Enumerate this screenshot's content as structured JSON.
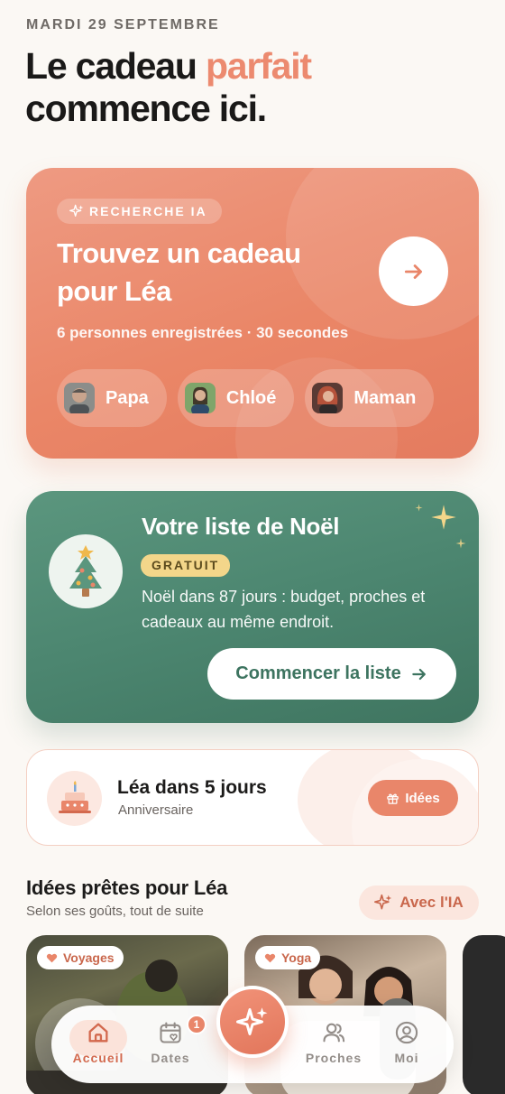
{
  "header": {
    "date": "MARDI 29 SEPTEMBRE",
    "headline_part1": "Le cadeau ",
    "headline_accent": "parfait",
    "headline_part2": "commence ici."
  },
  "ai_card": {
    "badge": "RECHERCHE IA",
    "title": "Trouvez un cadeau pour Léa",
    "subtitle": "6 personnes enregistrées · 30 secondes",
    "people": [
      {
        "name": "Papa"
      },
      {
        "name": "Chloé"
      },
      {
        "name": "Maman"
      }
    ]
  },
  "noel_card": {
    "title": "Votre liste de Noël",
    "badge": "GRATUIT",
    "description": "Noël dans 87 jours : budget, proches et cadeaux au même endroit.",
    "button": "Commencer la liste"
  },
  "birthday": {
    "title": "Léa dans 5 jours",
    "subtitle": "Anniversaire",
    "button": "Idées"
  },
  "ideas_section": {
    "title": "Idées prêtes pour Léa",
    "subtitle": "Selon ses goûts, tout de suite",
    "ai_button": "Avec l'IA",
    "cards": [
      {
        "tag": "Voyages"
      },
      {
        "tag": "Yoga"
      }
    ]
  },
  "tabbar": {
    "home": "Accueil",
    "dates": "Dates",
    "dates_badge": "1",
    "people": "Proches",
    "me": "Moi"
  },
  "colors": {
    "accent": "#ec8a6f",
    "green": "#4c8670",
    "background": "#fbf8f4"
  }
}
